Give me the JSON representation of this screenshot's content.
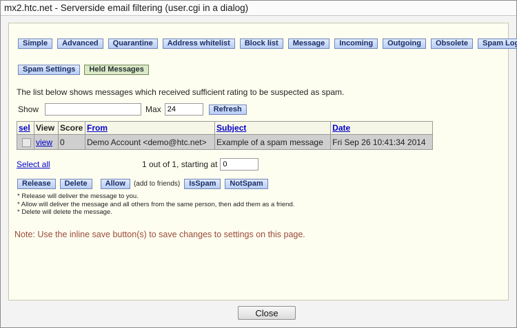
{
  "window": {
    "title": "mx2.htc.net - Serverside email filtering (user.cgi in a dialog)"
  },
  "tabs": [
    "Simple",
    "Advanced",
    "Quarantine",
    "Address whitelist",
    "Block list",
    "Message",
    "Incoming",
    "Outgoing",
    "Obsolete",
    "Spam Log"
  ],
  "subtabs": [
    "Spam Settings",
    "Held Messages"
  ],
  "intro": "The list below shows messages which received sufficient rating to be suspected as spam.",
  "filter": {
    "show_label": "Show",
    "show_value": "",
    "max_label": "Max",
    "max_value": "24",
    "refresh_label": "Refresh"
  },
  "table": {
    "headers": {
      "sel": "sel",
      "view": "View",
      "score": "Score",
      "from": "From",
      "subject": "Subject",
      "date": "Date"
    },
    "rows": [
      {
        "view": "view",
        "score": "0",
        "from": "Demo Account <demo@htc.net>",
        "subject": "Example of a spam message",
        "date": "Fri Sep 26 10:41:34 2014"
      }
    ]
  },
  "select_all": "Select all",
  "paging": {
    "text": "1 out of 1, starting at",
    "start_value": "0"
  },
  "actions": {
    "release": "Release",
    "delete": "Delete",
    "allow": "Allow",
    "allow_note": "(add to friends)",
    "isspam": "IsSpam",
    "notspam": "NotSpam"
  },
  "help": [
    "* Release will deliver the message to you.",
    "* Allow will deliver the message and all others from the same person, then add them as a friend.",
    "* Delete will delete the message."
  ],
  "save_note": "Note: Use the inline save button(s) to save changes to settings on this page.",
  "close_label": "Close"
}
